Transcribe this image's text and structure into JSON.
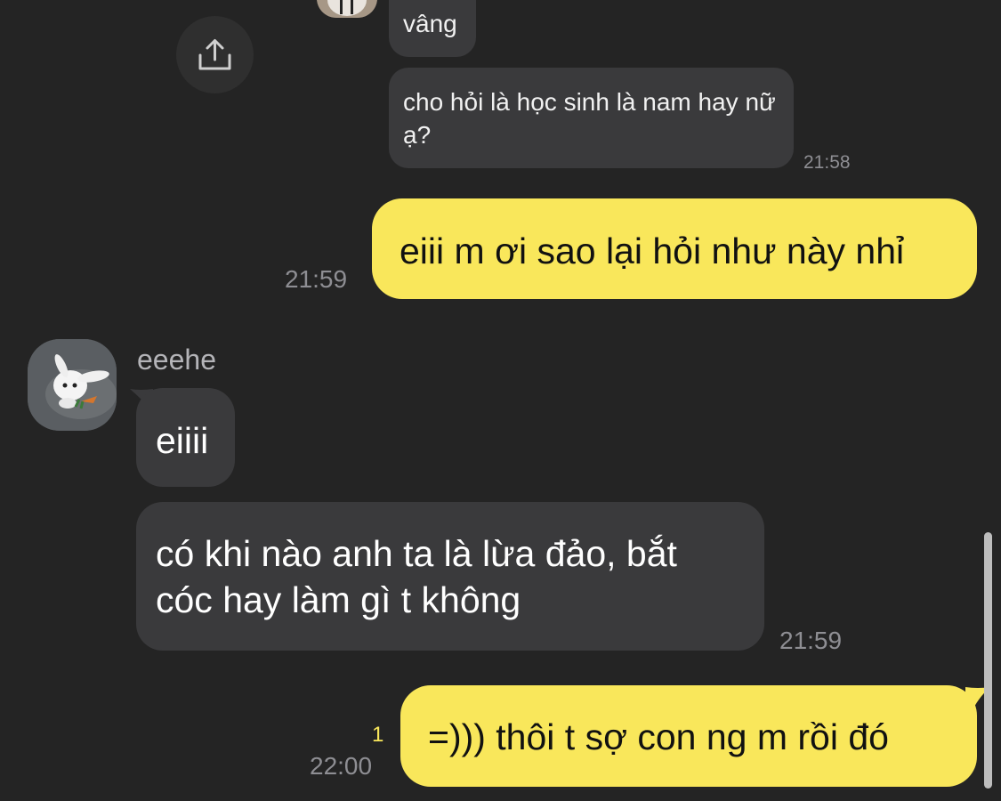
{
  "messages": [
    {
      "id": "m1",
      "direction": "in",
      "text": "vâng"
    },
    {
      "id": "m2",
      "direction": "in",
      "text": "cho hỏi là học sinh là nam hay nữ ạ?",
      "time": "21:58"
    },
    {
      "id": "m3",
      "direction": "out",
      "text": "eiii m ơi sao lại hỏi như này nhỉ",
      "time": "21:59"
    },
    {
      "id": "m4",
      "direction": "in",
      "sender": "eeehe",
      "text": "eiiii"
    },
    {
      "id": "m5",
      "direction": "in",
      "text": "có khi nào anh ta là lừa đảo, bắt cóc hay làm gì t không",
      "time": "21:59"
    },
    {
      "id": "m6",
      "direction": "out",
      "text": "=))) thôi t sợ con ng m rồi đó",
      "time": "22:00",
      "unread": "1"
    }
  ],
  "colors": {
    "background": "#242424",
    "incoming_bubble": "#3a3a3c",
    "outgoing_bubble": "#f9e75b",
    "unread_count": "#f9e75b",
    "timestamp": "#8e8e93"
  },
  "icons": {
    "share": "share-icon"
  }
}
